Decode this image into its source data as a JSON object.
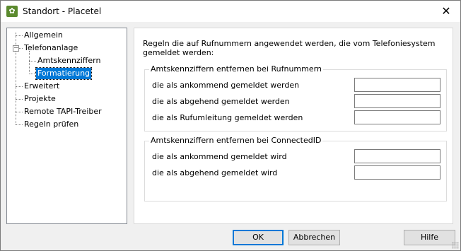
{
  "window": {
    "title": "Standort - Placetel",
    "close_glyph": "✕"
  },
  "tree": {
    "items": [
      {
        "label": "Allgemein"
      },
      {
        "label": "Telefonanlage",
        "expander": "−"
      },
      {
        "label": "Amtskennziffern"
      },
      {
        "label": "Formatierung",
        "selected": true
      },
      {
        "label": "Erweitert"
      },
      {
        "label": "Projekte"
      },
      {
        "label": "Remote TAPI-Treiber"
      },
      {
        "label": "Regeln prüfen"
      }
    ]
  },
  "content": {
    "intro": "Regeln die auf Rufnummern angewendet werden, die vom Telefoniesystem gemeldet werden:",
    "group1": {
      "title": "Amtskennziffern entfernen bei Rufnummern",
      "rows": [
        {
          "label": "die als ankommend gemeldet werden",
          "value": ""
        },
        {
          "label": "die als abgehend gemeldet werden",
          "value": ""
        },
        {
          "label": "die als Rufumleitung gemeldet werden",
          "value": ""
        }
      ]
    },
    "group2": {
      "title": "Amtskennziffern entfernen bei ConnectedID",
      "rows": [
        {
          "label": "die als ankommend gemeldet wird",
          "value": ""
        },
        {
          "label": "die als abgehend gemeldet wird",
          "value": ""
        }
      ]
    }
  },
  "buttons": {
    "ok": "OK",
    "cancel": "Abbrechen",
    "help": "Hilfe"
  },
  "colors": {
    "selection": "#0078d7",
    "icon": "#5b8a2e"
  }
}
